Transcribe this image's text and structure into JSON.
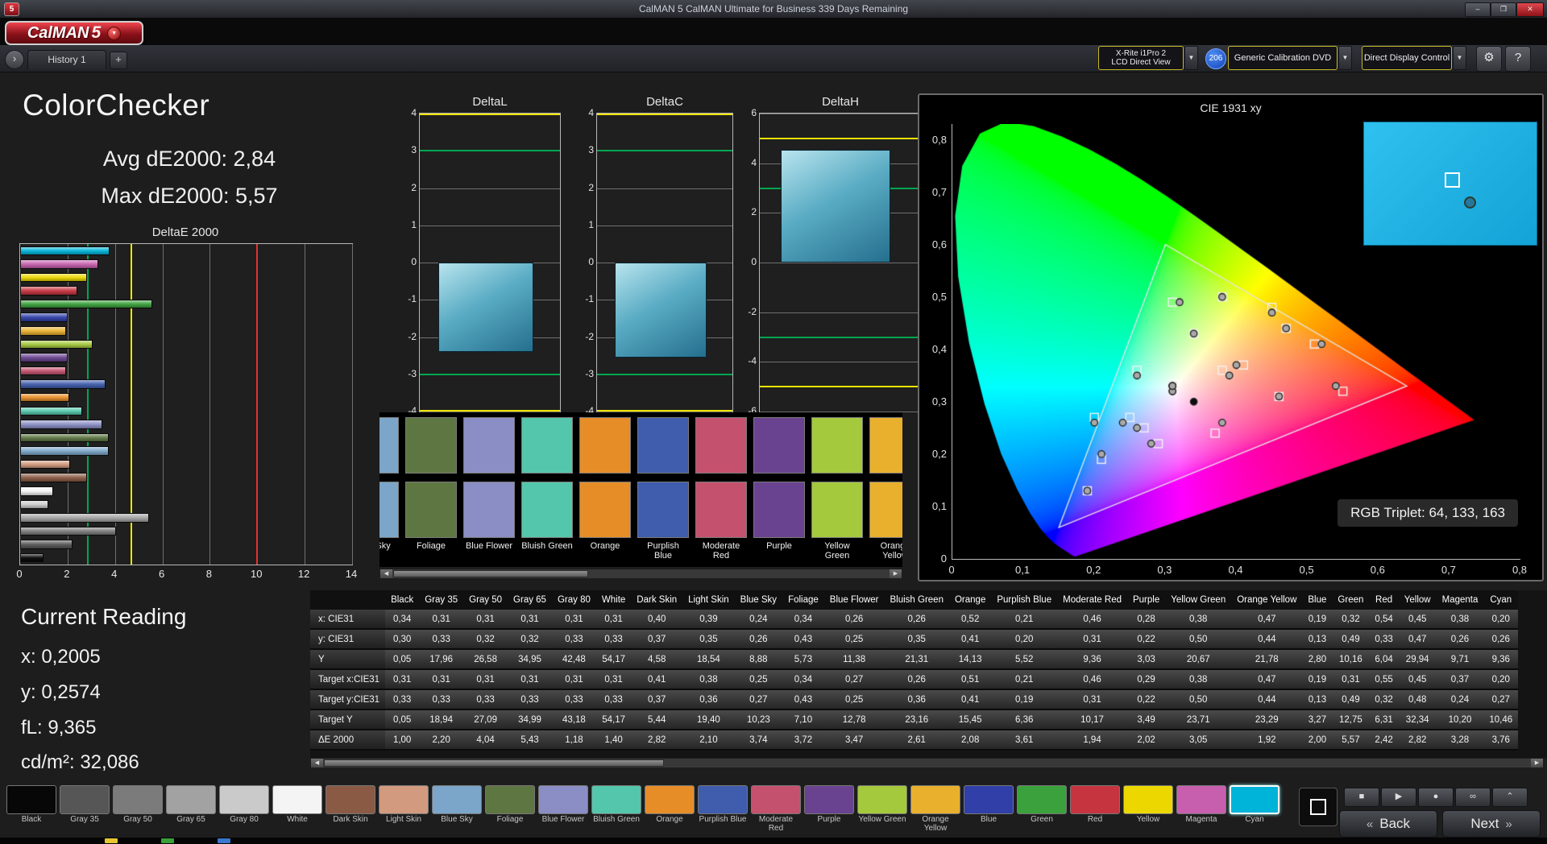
{
  "window": {
    "title": "CalMAN 5 CalMAN Ultimate for Business 339 Days Remaining",
    "app_badge": "5",
    "minimize": "–",
    "restore": "❐",
    "close": "✕"
  },
  "logo": {
    "brand": "CalMAN",
    "version": "5",
    "caret": "▼"
  },
  "tab_bar": {
    "collapse_arrow": "›",
    "history_tab": "History 1",
    "add_tab": "+"
  },
  "toolbar": {
    "meter": {
      "line1": "X-Rite i1Pro 2",
      "line2": "LCD Direct View"
    },
    "badge": "206",
    "source": "Generic Calibration DVD",
    "display_control": "Direct Display Control",
    "gear": "⚙",
    "help": "?",
    "caret": "▼"
  },
  "left_panel": {
    "title": "ColorChecker",
    "avg": "Avg dE2000: 2,84",
    "max": "Max dE2000: 5,57",
    "chart": {
      "title": "DeltaE 2000",
      "x_ticks": [
        0,
        2,
        4,
        6,
        8,
        10,
        12,
        14
      ],
      "xlim": [
        0,
        14
      ],
      "green_line": 2.84,
      "yellow_line": 4.7,
      "red_line": 10
    },
    "current_reading": {
      "title": "Current Reading",
      "x": "x: 0,2005",
      "y": "y: 0,2574",
      "fl": "fL: 9,365",
      "cd": "cd/m²: 32,086"
    }
  },
  "delta_charts": [
    {
      "title": "DeltaL",
      "min": -4,
      "max": 4,
      "ticks": [
        4,
        3,
        2,
        1,
        0,
        -1,
        -2,
        -3,
        -4
      ],
      "value": -2.4,
      "green_limit": 3,
      "yellow_limit": 4
    },
    {
      "title": "DeltaC",
      "min": -4,
      "max": 4,
      "ticks": [
        4,
        3,
        2,
        1,
        0,
        -1,
        -2,
        -3,
        -4
      ],
      "value": -2.55,
      "green_limit": 3,
      "yellow_limit": 4
    },
    {
      "title": "DeltaH",
      "min": -6,
      "max": 6,
      "ticks": [
        6,
        4,
        2,
        0,
        -2,
        -4,
        -6
      ],
      "value": 4.55,
      "green_limit": 3,
      "yellow_limit": 5
    }
  ],
  "cie": {
    "title": "CIE 1931 xy",
    "axis_ticks": [
      "0",
      "0,1",
      "0,2",
      "0,3",
      "0,4",
      "0,5",
      "0,6",
      "0,7",
      "0,8"
    ],
    "xlim": [
      0,
      0.8
    ],
    "ylim": [
      0,
      0.83
    ],
    "gamut_triangle": [
      [
        0.64,
        0.33
      ],
      [
        0.3,
        0.6
      ],
      [
        0.15,
        0.06
      ]
    ],
    "rgb_triplet": "RGB Triplet: 64, 133, 163",
    "patch_preview_color": "#2fc1ef"
  },
  "selected_patch": "Cyan",
  "patches": [
    {
      "name": "Black",
      "color": "#070707"
    },
    {
      "name": "Gray 35",
      "color": "#565656"
    },
    {
      "name": "Gray 50",
      "color": "#7b7b7b"
    },
    {
      "name": "Gray 65",
      "color": "#a2a2a2"
    },
    {
      "name": "Gray 80",
      "color": "#cacaca"
    },
    {
      "name": "White",
      "color": "#f4f4f4"
    },
    {
      "name": "Dark Skin",
      "color": "#8a5a44"
    },
    {
      "name": "Light Skin",
      "color": "#d29a7e"
    },
    {
      "name": "Blue Sky",
      "color": "#7ba6c9"
    },
    {
      "name": "Foliage",
      "color": "#5e7642"
    },
    {
      "name": "Blue Flower",
      "color": "#8a8ec4"
    },
    {
      "name": "Bluish Green",
      "color": "#54c6ab"
    },
    {
      "name": "Orange",
      "color": "#e68d28"
    },
    {
      "name": "Purplish Blue",
      "color": "#3f5cad"
    },
    {
      "name": "Moderate Red",
      "color": "#c4526e"
    },
    {
      "name": "Purple",
      "color": "#6a4390"
    },
    {
      "name": "Yellow Green",
      "color": "#a4c93c"
    },
    {
      "name": "Orange Yellow",
      "color": "#e9b02e"
    },
    {
      "name": "Blue",
      "color": "#3040a8"
    },
    {
      "name": "Green",
      "color": "#3ba13c"
    },
    {
      "name": "Red",
      "color": "#c63440"
    },
    {
      "name": "Yellow",
      "color": "#ecd800"
    },
    {
      "name": "Magenta",
      "color": "#c75fae"
    },
    {
      "name": "Cyan",
      "color": "#00b3d8"
    }
  ],
  "table": {
    "corner": "",
    "rows": [
      {
        "label": "x: CIE31",
        "values": [
          "0,34",
          "0,31",
          "0,31",
          "0,31",
          "0,31",
          "0,31",
          "0,40",
          "0,39",
          "0,24",
          "0,34",
          "0,26",
          "0,26",
          "0,52",
          "0,21",
          "0,46",
          "0,28",
          "0,38",
          "0,47",
          "0,19",
          "0,32",
          "0,54",
          "0,45",
          "0,38",
          "0,20"
        ]
      },
      {
        "label": "y: CIE31",
        "values": [
          "0,30",
          "0,33",
          "0,32",
          "0,32",
          "0,33",
          "0,33",
          "0,37",
          "0,35",
          "0,26",
          "0,43",
          "0,25",
          "0,35",
          "0,41",
          "0,20",
          "0,31",
          "0,22",
          "0,50",
          "0,44",
          "0,13",
          "0,49",
          "0,33",
          "0,47",
          "0,26",
          "0,26"
        ]
      },
      {
        "label": "Y",
        "values": [
          "0,05",
          "17,96",
          "26,58",
          "34,95",
          "42,48",
          "54,17",
          "4,58",
          "18,54",
          "8,88",
          "5,73",
          "11,38",
          "21,31",
          "14,13",
          "5,52",
          "9,36",
          "3,03",
          "20,67",
          "21,78",
          "2,80",
          "10,16",
          "6,04",
          "29,94",
          "9,71",
          "9,36"
        ]
      },
      {
        "label": "Target x:CIE31",
        "values": [
          "0,31",
          "0,31",
          "0,31",
          "0,31",
          "0,31",
          "0,31",
          "0,41",
          "0,38",
          "0,25",
          "0,34",
          "0,27",
          "0,26",
          "0,51",
          "0,21",
          "0,46",
          "0,29",
          "0,38",
          "0,47",
          "0,19",
          "0,31",
          "0,55",
          "0,45",
          "0,37",
          "0,20"
        ]
      },
      {
        "label": "Target y:CIE31",
        "values": [
          "0,33",
          "0,33",
          "0,33",
          "0,33",
          "0,33",
          "0,33",
          "0,37",
          "0,36",
          "0,27",
          "0,43",
          "0,25",
          "0,36",
          "0,41",
          "0,19",
          "0,31",
          "0,22",
          "0,50",
          "0,44",
          "0,13",
          "0,49",
          "0,32",
          "0,48",
          "0,24",
          "0,27"
        ]
      },
      {
        "label": "Target Y",
        "values": [
          "0,05",
          "18,94",
          "27,09",
          "34,99",
          "43,18",
          "54,17",
          "5,44",
          "19,40",
          "10,23",
          "7,10",
          "12,78",
          "23,16",
          "15,45",
          "6,36",
          "10,17",
          "3,49",
          "23,71",
          "23,29",
          "3,27",
          "12,75",
          "6,31",
          "32,34",
          "10,20",
          "10,46"
        ]
      },
      {
        "label": "ΔE 2000",
        "values": [
          "1,00",
          "2,20",
          "4,04",
          "5,43",
          "1,18",
          "1,40",
          "2,82",
          "2,10",
          "3,74",
          "3,72",
          "3,47",
          "2,61",
          "2,08",
          "3,61",
          "1,94",
          "2,02",
          "3,05",
          "1,92",
          "2,00",
          "5,57",
          "2,42",
          "2,82",
          "3,28",
          "3,76"
        ]
      }
    ]
  },
  "strip": {
    "start_index": 8,
    "count": 10
  },
  "nav": {
    "back": "Back",
    "next": "Next",
    "back_chevron": "«",
    "next_chevron": "»",
    "stop": "■",
    "play": "▶",
    "record": "●",
    "continuous": "∞",
    "up": "⌃"
  }
}
